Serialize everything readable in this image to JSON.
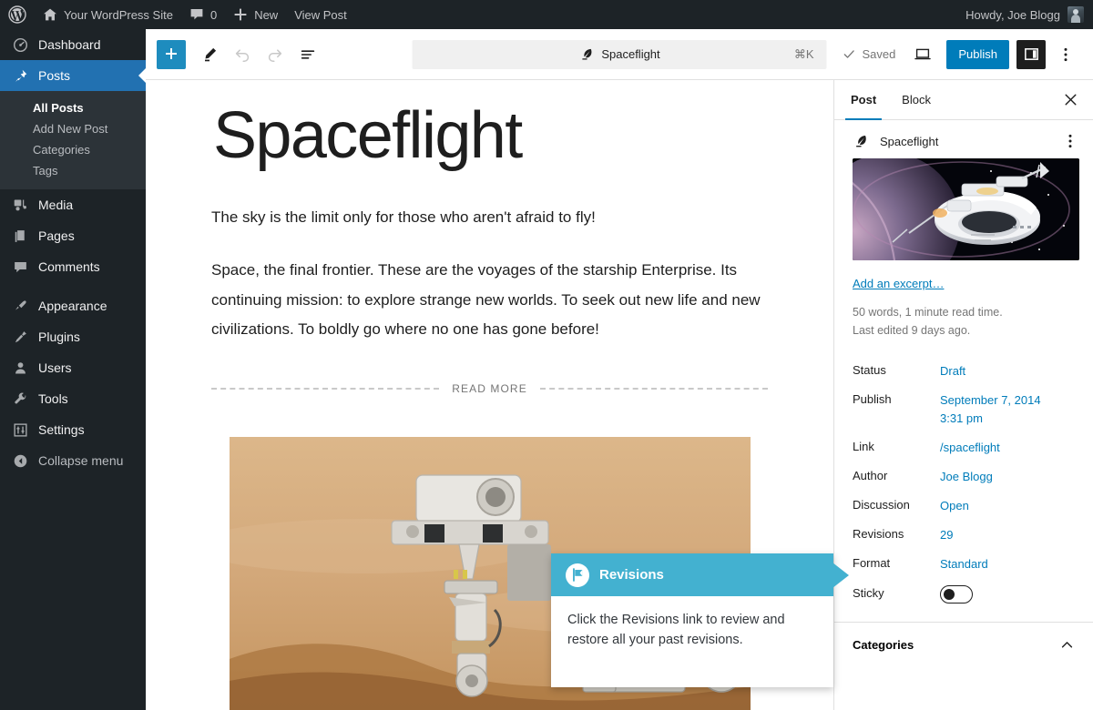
{
  "adminbar": {
    "logo_icon": "wordpress-logo-icon",
    "site_name": "Your WordPress Site",
    "home_icon": "home-icon",
    "comments_icon": "comment-bubble-icon",
    "comment_count": "0",
    "new_icon": "plus-icon",
    "new_label": "New",
    "view_post_label": "View Post",
    "greeting": "Howdy, Joe Blogg",
    "avatar_icon": "user-avatar"
  },
  "adminmenu": {
    "items": [
      {
        "label": "Dashboard",
        "icon": "dashboard-icon"
      },
      {
        "label": "Posts",
        "icon": "pin-icon",
        "current": true
      },
      {
        "label": "Media",
        "icon": "media-icon"
      },
      {
        "label": "Pages",
        "icon": "pages-icon"
      },
      {
        "label": "Comments",
        "icon": "comments-icon"
      },
      {
        "label": "Appearance",
        "icon": "brush-icon"
      },
      {
        "label": "Plugins",
        "icon": "plug-icon"
      },
      {
        "label": "Users",
        "icon": "user-icon"
      },
      {
        "label": "Tools",
        "icon": "wrench-icon"
      },
      {
        "label": "Settings",
        "icon": "sliders-icon"
      }
    ],
    "submenu": [
      {
        "label": "All Posts",
        "current": true
      },
      {
        "label": "Add New Post",
        "current": false
      },
      {
        "label": "Categories",
        "current": false
      },
      {
        "label": "Tags",
        "current": false
      }
    ],
    "collapse_label": "Collapse menu",
    "collapse_icon": "collapse-arrow-icon"
  },
  "toolbar": {
    "add_block_icon": "plus-icon",
    "tools_icon": "pencil-icon",
    "undo_icon": "undo-arrow-icon",
    "redo_icon": "redo-arrow-icon",
    "list_view_icon": "list-view-icon",
    "command_bar": {
      "icon": "feather-post-icon",
      "value": "Spaceflight",
      "shortcut": "⌘K"
    },
    "saved_label": "Saved",
    "saved_icon": "check-icon",
    "preview_icon": "laptop-preview-icon",
    "publish_label": "Publish",
    "sidebar_toggle_icon": "panel-toggle-icon",
    "options_icon": "three-dots-vertical-icon"
  },
  "post": {
    "title": "Spaceflight",
    "paragraph_1": "The sky is the limit only for those who aren't afraid to fly!",
    "paragraph_2": "Space, the final frontier. These are the voyages of the starship Enterprise. Its continuing mission: to explore strange new worlds. To seek out new life and new civilizations. To boldly go where no one has gone before!",
    "read_more_label": "READ MORE",
    "rover_image_alt": "mars-rover-image"
  },
  "settings": {
    "tabs": [
      {
        "label": "Post",
        "active": true
      },
      {
        "label": "Block",
        "active": false
      }
    ],
    "close_icon": "close-x-icon",
    "document": {
      "icon": "feather-post-icon",
      "title": "Spaceflight",
      "more_icon": "three-dots-vertical-icon"
    },
    "featured_image_alt": "space-station-featured-image",
    "excerpt_link": "Add an excerpt…",
    "word_count_note": "50 words, 1 minute read time.",
    "last_edited_note": "Last edited 9 days ago.",
    "fields": [
      {
        "label": "Status",
        "value": "Draft",
        "type": "link"
      },
      {
        "label": "Publish",
        "value": "September 7, 2014 3:31 pm",
        "type": "link"
      },
      {
        "label": "Link",
        "value": "/spaceflight",
        "type": "link"
      },
      {
        "label": "Author",
        "value": "Joe Blogg",
        "type": "link"
      },
      {
        "label": "Discussion",
        "value": "Open",
        "type": "link"
      },
      {
        "label": "Revisions",
        "value": "29",
        "type": "link"
      },
      {
        "label": "Format",
        "value": "Standard",
        "type": "link"
      },
      {
        "label": "Sticky",
        "value": "off",
        "type": "toggle"
      }
    ],
    "categories_label": "Categories",
    "categories_chevron_icon": "chevron-up-icon"
  },
  "pointer": {
    "icon": "flag-icon",
    "title": "Revisions",
    "body": "Click the Revisions link to review and restore all your past revisions."
  },
  "colors": {
    "admin_dark": "#1d2327",
    "admin_blue": "#2271b1",
    "publish_blue": "#007cba",
    "link_blue": "#007cba",
    "pointer_blue": "#43b1d0"
  }
}
